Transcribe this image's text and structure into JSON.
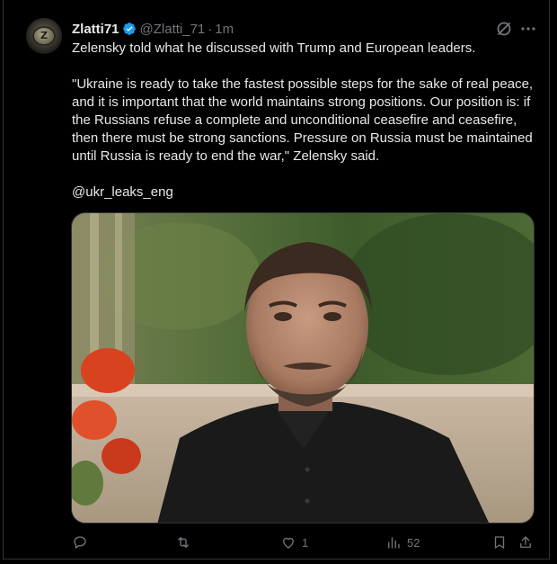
{
  "author": {
    "display_name": "Zlatti71",
    "handle": "@Zlatti_71",
    "separator": "·",
    "time": "1m",
    "avatar_icon": "coin-z-avatar",
    "verified_color": "#1d9bf0"
  },
  "tweet": {
    "text": "Zelensky told what he discussed with Trump and European leaders.\n\n\"Ukraine is ready to take the fastest possible steps for the sake of real peace, and it is important that the world maintains strong positions. Our position is: if the Russians refuse a complete and unconditional ceasefire and ceasefire, then there must be strong sanctions. Pressure on Russia must be maintained until Russia is ready to end the war,\" Zelensky said.\n\n@ukr_leaks_eng"
  },
  "media": {
    "type": "photo",
    "description_icon": "photo-portrait"
  },
  "actions": {
    "reply_count": "",
    "retweet_count": "",
    "like_count": "1",
    "views_count": "52"
  },
  "colors": {
    "background": "#000000",
    "text": "#e7e9ea",
    "secondary": "#71767b",
    "border": "#2f3336",
    "accent": "#1d9bf0"
  }
}
